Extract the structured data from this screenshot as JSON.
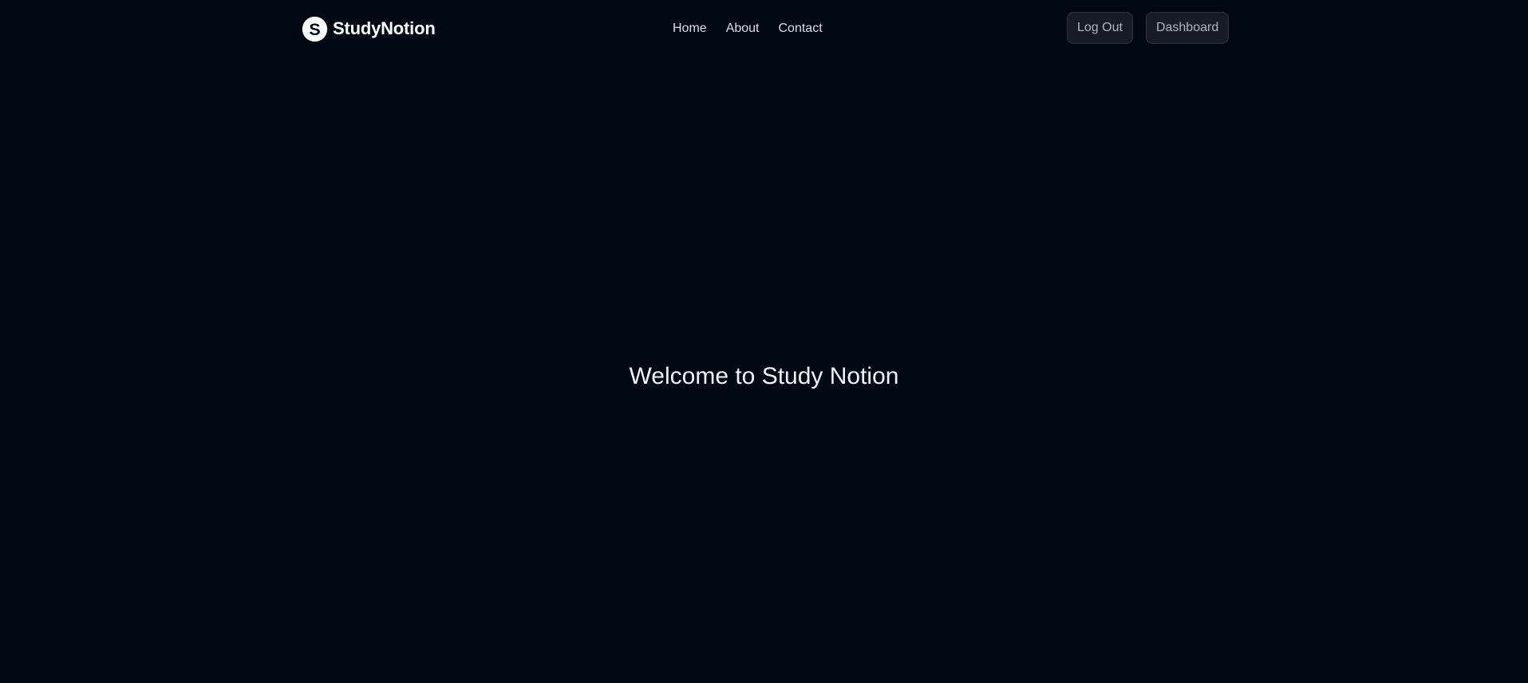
{
  "navbar": {
    "logo": {
      "text": "StudyNotion",
      "icon": "studynotion-logo-icon"
    },
    "links": [
      {
        "label": "Home"
      },
      {
        "label": "About"
      },
      {
        "label": "Contact"
      }
    ],
    "buttons": {
      "logout_label": "Log Out",
      "dashboard_label": "Dashboard"
    }
  },
  "main": {
    "title": "Welcome to Study Notion"
  },
  "colors": {
    "background": "#000814",
    "text": "#f1f2ff",
    "button_bg": "#161d29",
    "button_border": "#2c333f",
    "button_text": "#afb2bf"
  }
}
